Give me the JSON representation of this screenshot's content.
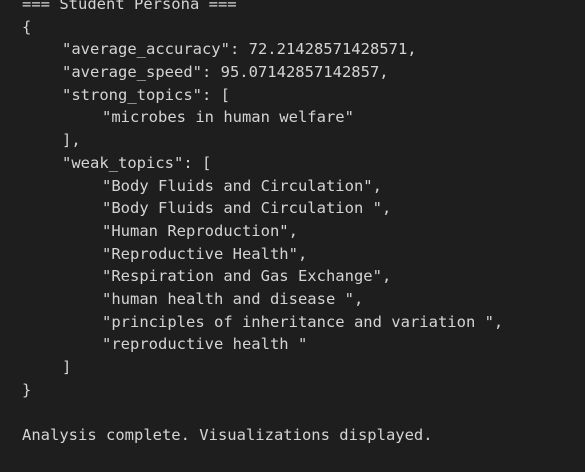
{
  "output": {
    "header": "=== Student Persona ===",
    "open_brace": "{",
    "close_brace": "}",
    "entries": {
      "average_accuracy": "\"average_accuracy\": 72.21428571428571,",
      "average_speed": "\"average_speed\": 95.07142857142857,",
      "strong_topics_key": "\"strong_topics\": [",
      "strong_topics_close": "],",
      "weak_topics_key": "\"weak_topics\": [",
      "weak_topics_close": "]"
    },
    "strong_topics": [
      "\"microbes in human welfare\""
    ],
    "weak_topics": [
      "\"Body Fluids and Circulation\",",
      "\"Body Fluids and Circulation \",",
      "\"Human Reproduction\",",
      "\"Reproductive Health\",",
      "\"Respiration and Gas Exchange\",",
      "\"human health and disease \",",
      "\"principles of inheritance and variation \",",
      "\"reproductive health \""
    ],
    "status": "Analysis complete. Visualizations displayed."
  },
  "colors": {
    "background": "#1e1e1e",
    "text": "#d4d4d4"
  }
}
